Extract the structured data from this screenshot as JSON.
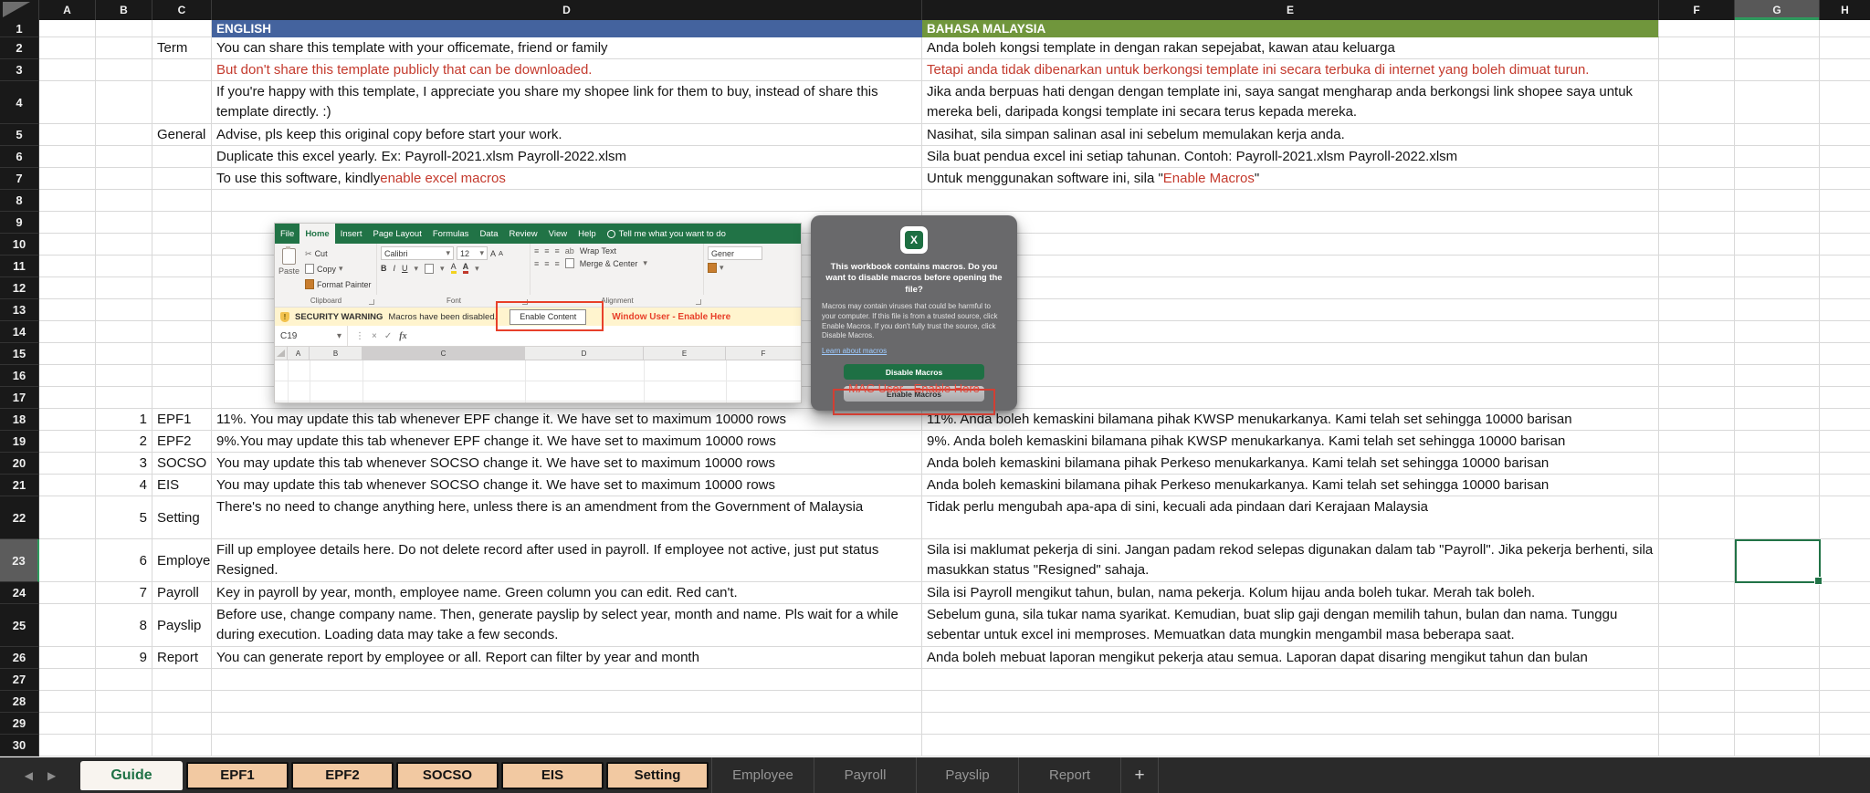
{
  "colors": {
    "english_header": "#44639e",
    "malay_header": "#70963c",
    "warning_text_red": "#c43a2d",
    "annotation_red": "#e8402a",
    "excel_green": "#217346",
    "selection_green": "#217346",
    "tab_peach": "#f2c9a2"
  },
  "icons": {
    "prev": "◀",
    "next": "▶",
    "add": "+",
    "dropdown": "▾",
    "cut": "✂",
    "cancel": "×",
    "confirm": "✓",
    "ellipsis": "⋮",
    "warning": "!",
    "fx": "fx"
  },
  "spreadsheet": {
    "columns": [
      "A",
      "B",
      "C",
      "D",
      "E",
      "F",
      "G",
      "H"
    ],
    "selected_column": "G",
    "selected_row_number": "23",
    "rows": [
      {
        "n": "1",
        "d": "ENGLISH",
        "e": "BAHASA MALAYSIA"
      },
      {
        "n": "2",
        "c": "Term",
        "d": "You can share this template with your officemate, friend or family",
        "e": "Anda boleh kongsi template in dengan rakan sepejabat, kawan atau keluarga"
      },
      {
        "n": "3",
        "d": "But don't share this template publicly that can be downloaded.",
        "e": "Tetapi anda tidak dibenarkan untuk berkongsi template ini secara terbuka di internet yang boleh dimuat turun."
      },
      {
        "n": "4",
        "d": "If you're happy with this template, I appreciate you share my shopee link for them to buy, instead of share this template directly. :)",
        "e": "Jika anda berpuas hati dengan dengan template ini, saya sangat mengharap anda berkongsi link shopee saya untuk mereka beli, daripada kongsi template ini secara terus kepada mereka."
      },
      {
        "n": "5",
        "c": "General",
        "d": "Advise, pls keep this original copy before start your work.",
        "e": "Nasihat, sila simpan salinan asal ini sebelum memulakan kerja anda."
      },
      {
        "n": "6",
        "d": "Duplicate this excel yearly. Ex: Payroll-2021.xlsm Payroll-2022.xlsm",
        "e": "Sila buat pendua excel ini setiap tahunan. Contoh: Payroll-2021.xlsm Payroll-2022.xlsm"
      },
      {
        "n": "7",
        "d_pre": "To use this software, kindly ",
        "d_red": "enable excel macros",
        "e_pre": "Untuk menggunakan software ini, sila \"",
        "e_red": "Enable Macros",
        "e_post": "\""
      },
      {
        "n": "8"
      },
      {
        "n": "9"
      },
      {
        "n": "10"
      },
      {
        "n": "11"
      },
      {
        "n": "12"
      },
      {
        "n": "13"
      },
      {
        "n": "14"
      },
      {
        "n": "15"
      },
      {
        "n": "16"
      },
      {
        "n": "17"
      },
      {
        "n": "18",
        "b": "1",
        "c": "EPF1",
        "d": "11%. You may update this tab whenever EPF change it. We have set to maximum 10000 rows",
        "e": "11%. Anda boleh kemaskini bilamana pihak KWSP menukarkanya. Kami telah set sehingga 10000 barisan"
      },
      {
        "n": "19",
        "b": "2",
        "c": "EPF2",
        "d": "9%.You may update this tab whenever EPF change it. We have set to maximum 10000 rows",
        "e": "9%. Anda boleh kemaskini bilamana pihak KWSP menukarkanya. Kami telah set sehingga 10000 barisan"
      },
      {
        "n": "20",
        "b": "3",
        "c": "SOCSO",
        "d": "You may update this tab whenever SOCSO change it. We have set to maximum 10000 rows",
        "e": "Anda boleh kemaskini bilamana pihak Perkeso menukarkanya. Kami telah set sehingga 10000 barisan"
      },
      {
        "n": "21",
        "b": "4",
        "c": "EIS",
        "d": "You may update this tab whenever SOCSO change it. We have set to maximum 10000 rows",
        "e": "Anda boleh kemaskini bilamana pihak Perkeso menukarkanya. Kami telah set sehingga 10000 barisan"
      },
      {
        "n": "22",
        "b": "5",
        "c": "Setting",
        "d": "There's no need to change anything here, unless there is an amendment from the Government of Malaysia",
        "e": "Tidak perlu mengubah apa-apa di sini, kecuali ada pindaan dari Kerajaan Malaysia"
      },
      {
        "n": "23",
        "b": "6",
        "c": "Employee",
        "d": "Fill up employee details here. Do not delete record after used in payroll. If employee not active, just put status Resigned.",
        "e": "Sila isi maklumat pekerja di sini. Jangan padam rekod selepas digunakan dalam tab \"Payroll\". Jika pekerja berhenti, sila masukkan status \"Resigned\" sahaja."
      },
      {
        "n": "24",
        "b": "7",
        "c": "Payroll",
        "d": "Key in payroll by year, month, employee name. Green column you can edit. Red can't.",
        "e": "Sila isi Payroll mengikut tahun, bulan, nama pekerja. Kolum hijau anda boleh tukar. Merah tak boleh."
      },
      {
        "n": "25",
        "b": "8",
        "c": "Payslip",
        "d": "Before use, change company name. Then, generate payslip by select year, month and name. Pls wait for a while during execution. Loading data may take a few seconds.",
        "e": "Sebelum guna, sila tukar nama syarikat. Kemudian, buat slip gaji dengan memilih tahun, bulan dan nama. Tunggu sebentar untuk excel ini memproses. Memuatkan data mungkin mengambil masa beberapa saat."
      },
      {
        "n": "26",
        "b": "9",
        "c": "Report",
        "d": "You can generate report by employee or all. Report can filter by year and month",
        "e": "Anda boleh mebuat laporan mengikut pekerja atau semua. Laporan dapat disaring mengikut tahun dan bulan"
      },
      {
        "n": "27"
      },
      {
        "n": "28"
      },
      {
        "n": "29"
      },
      {
        "n": "30"
      }
    ]
  },
  "embedded_excel_screenshot": {
    "ribbon_tabs": [
      "File",
      "Home",
      "Insert",
      "Page Layout",
      "Formulas",
      "Data",
      "Review",
      "View",
      "Help"
    ],
    "tell_me": "Tell me what you want to do",
    "clipboard": {
      "paste": "Paste",
      "cut": "Cut",
      "copy": "Copy",
      "format_painter": "Format Painter",
      "group": "Clipboard"
    },
    "font": {
      "name": "Calibri",
      "size": "12",
      "bold": "B",
      "italic": "I",
      "underline": "U",
      "a_big": "A",
      "a_small": "A",
      "group": "Font"
    },
    "alignment": {
      "wrap_text": "Wrap Text",
      "merge_center": "Merge & Center",
      "ab": "ab",
      "group": "Alignment"
    },
    "number_format": "Gener",
    "security_bar": {
      "label": "SECURITY WARNING",
      "message": "Macros have been disabled.",
      "button": "Enable Content",
      "annotation": "Window User - Enable Here"
    },
    "formula_bar": {
      "name_box": "C19"
    },
    "mini_columns": [
      "A",
      "B",
      "C",
      "D",
      "E",
      "F"
    ]
  },
  "embedded_mac_dialog": {
    "app_initial": "X",
    "title": "This workbook contains macros. Do you want to disable macros before opening the file?",
    "body": "Macros may contain viruses that could be harmful to your computer.  If this file is from a trusted source, click Enable Macros. If you don't fully trust the source, click Disable Macros.",
    "link": "Learn about macros",
    "disable_button": "Disable Macros",
    "enable_button": "Enable Macros",
    "annotation": "MAC User - Enable Here"
  },
  "sheet_tabs": [
    "Guide",
    "EPF1",
    "EPF2",
    "SOCSO",
    "EIS",
    "Setting",
    "Employee",
    "Payroll",
    "Payslip",
    "Report"
  ]
}
